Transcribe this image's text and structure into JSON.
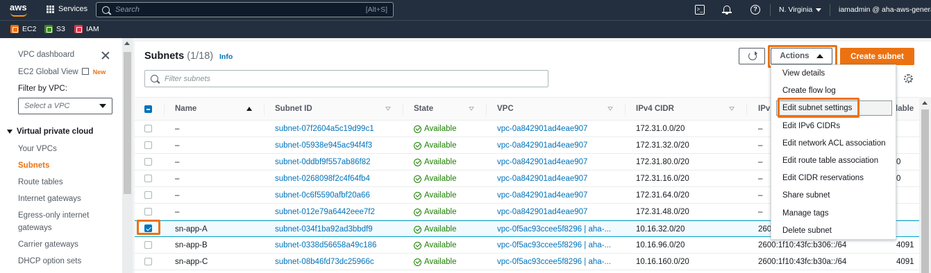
{
  "topnav": {
    "logo_text": "aws",
    "services_label": "Services",
    "search_placeholder": "Search",
    "search_shortcut": "[Alt+S]",
    "region": "N. Virginia",
    "account": "iamadmin @ aha-aws-general"
  },
  "favorites": [
    {
      "label": "EC2",
      "color": "#ec7211"
    },
    {
      "label": "S3",
      "color": "#3f8624"
    },
    {
      "label": "IAM",
      "color": "#dd344c"
    }
  ],
  "sidebar": {
    "vpc_dashboard": "VPC dashboard",
    "ec2_global_view": "EC2 Global View",
    "new_tag": "New",
    "filter_label": "Filter by VPC:",
    "filter_placeholder": "Select a VPC",
    "section_title": "Virtual private cloud",
    "items": [
      "Your VPCs",
      "Subnets",
      "Route tables",
      "Internet gateways",
      "Egress-only internet",
      "gateways",
      "Carrier gateways",
      "DHCP option sets"
    ],
    "active_item": "Subnets"
  },
  "header": {
    "title": "Subnets",
    "count": "(1/18)",
    "info": "Info",
    "actions_label": "Actions",
    "create_label": "Create subnet",
    "filter_placeholder": "Filter subnets"
  },
  "table": {
    "columns": [
      "Name",
      "Subnet ID",
      "State",
      "VPC",
      "IPv4 CIDR",
      "IPv",
      "lable"
    ],
    "rows": [
      {
        "name": "–",
        "subnet_id": "subnet-07f2604a5c19d99c1",
        "state": "Available",
        "vpc": "vpc-0a842901ad4eae907",
        "ipv4": "172.31.0.0/20",
        "ipv6": "–",
        "avail": "",
        "selected": false
      },
      {
        "name": "–",
        "subnet_id": "subnet-05938e945ac94f4f3",
        "state": "Available",
        "vpc": "vpc-0a842901ad4eae907",
        "ipv4": "172.31.32.0/20",
        "ipv6": "–",
        "avail": "",
        "selected": false
      },
      {
        "name": "–",
        "subnet_id": "subnet-0ddbf9f557ab86f82",
        "state": "Available",
        "vpc": "vpc-0a842901ad4eae907",
        "ipv4": "172.31.80.0/20",
        "ipv6": "–",
        "avail": "0",
        "selected": false
      },
      {
        "name": "–",
        "subnet_id": "subnet-0268098f2c4f64fb4",
        "state": "Available",
        "vpc": "vpc-0a842901ad4eae907",
        "ipv4": "172.31.16.0/20",
        "ipv6": "–",
        "avail": "0",
        "selected": false
      },
      {
        "name": "–",
        "subnet_id": "subnet-0c6f5590afbf20a66",
        "state": "Available",
        "vpc": "vpc-0a842901ad4eae907",
        "ipv4": "172.31.64.0/20",
        "ipv6": "–",
        "avail": "",
        "selected": false
      },
      {
        "name": "–",
        "subnet_id": "subnet-012e79a6442eee7f2",
        "state": "Available",
        "vpc": "vpc-0a842901ad4eae907",
        "ipv4": "172.31.48.0/20",
        "ipv6": "–",
        "avail": "",
        "selected": false
      },
      {
        "name": "sn-app-A",
        "subnet_id": "subnet-034f1ba92ad3bbdf9",
        "state": "Available",
        "vpc": "vpc-0f5ac93ccee5f8296 | aha-...",
        "ipv4": "10.16.32.0/20",
        "ipv6": "2600",
        "avail": "",
        "selected": true
      },
      {
        "name": "sn-app-B",
        "subnet_id": "subnet-0338d56658a49c186",
        "state": "Available",
        "vpc": "vpc-0f5ac93ccee5f8296 | aha-...",
        "ipv4": "10.16.96.0/20",
        "ipv6": "2600:1f10:43fc:b306::/64",
        "avail": "4091",
        "selected": false
      },
      {
        "name": "sn-app-C",
        "subnet_id": "subnet-08b46fd73dc25966c",
        "state": "Available",
        "vpc": "vpc-0f5ac93ccee5f8296 | aha-...",
        "ipv4": "10.16.160.0/20",
        "ipv6": "2600:1f10:43fc:b30a::/64",
        "avail": "4091",
        "selected": false
      }
    ]
  },
  "actions_menu": [
    "View details",
    "Create flow log",
    "Edit subnet settings",
    "Edit IPv6 CIDRs",
    "Edit network ACL association",
    "Edit route table association",
    "Edit CIDR reservations",
    "Share subnet",
    "Manage tags",
    "Delete subnet"
  ],
  "colors": {
    "accent": "#ec7211",
    "link": "#0073bb",
    "success": "#1d8102",
    "nav_bg": "#232f3e"
  }
}
